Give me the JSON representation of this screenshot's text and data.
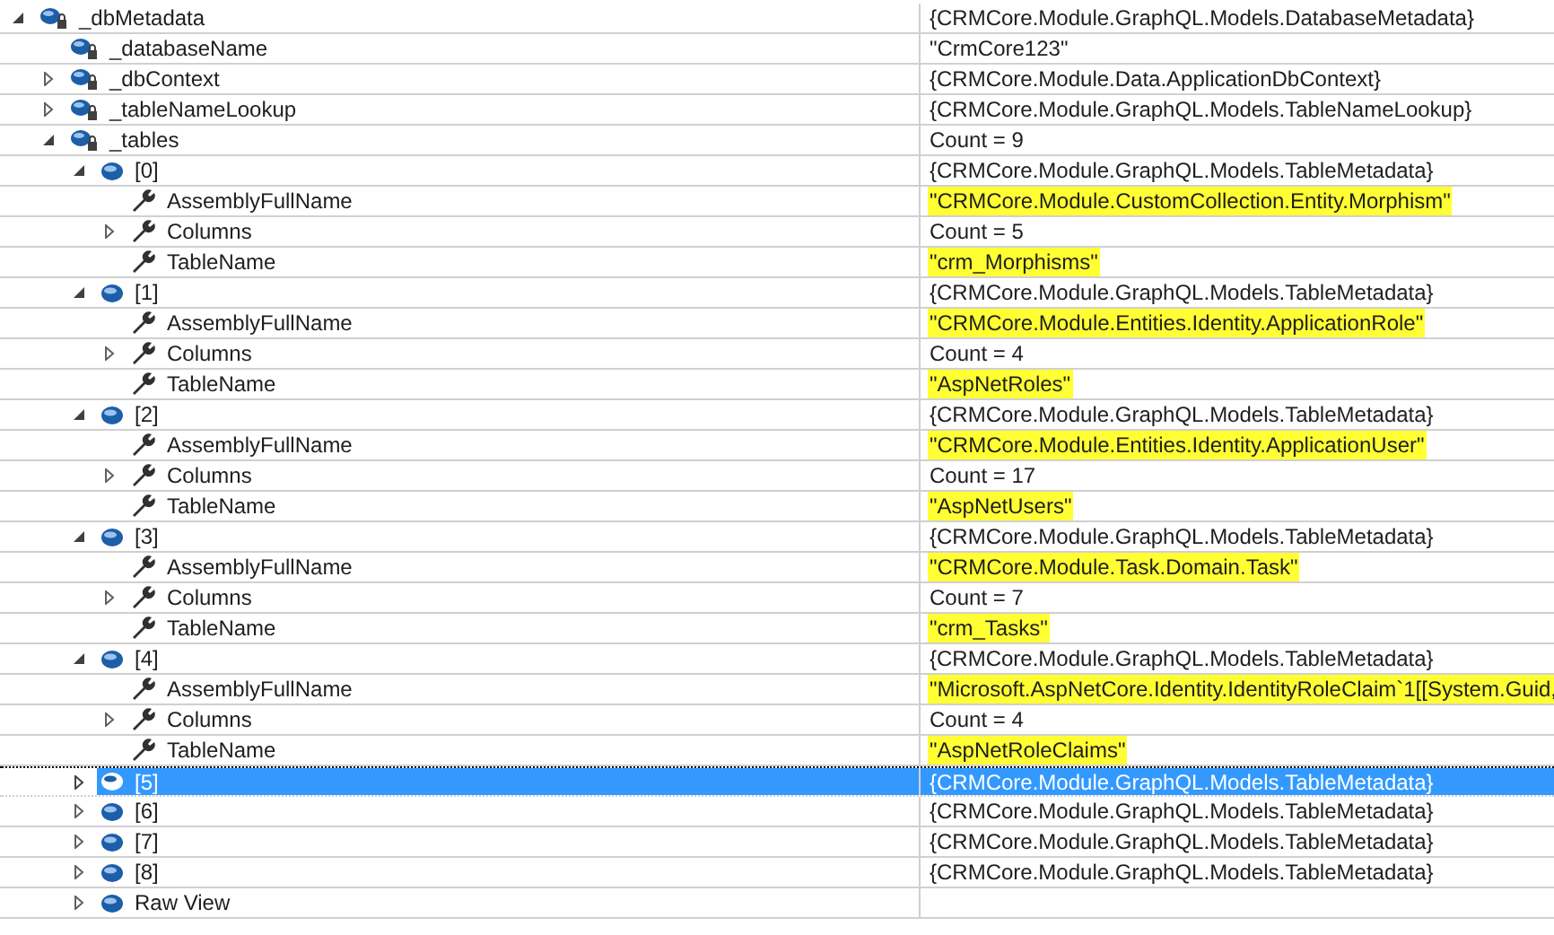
{
  "rows": [
    {
      "name": "_dbMetadata",
      "kind": "field",
      "expanded": true,
      "value": "{CRMCore.Module.GraphQL.Models.DatabaseMetadata}",
      "highlighted": false,
      "selected": false,
      "children": [
        {
          "name": "_databaseName",
          "kind": "field",
          "value": "\"CrmCore123\"",
          "highlighted": false,
          "selected": false
        },
        {
          "name": "_dbContext",
          "kind": "field",
          "expanded": false,
          "value": "{CRMCore.Module.Data.ApplicationDbContext}",
          "highlighted": false,
          "selected": false
        },
        {
          "name": "_tableNameLookup",
          "kind": "field",
          "expanded": false,
          "value": "{CRMCore.Module.GraphQL.Models.TableNameLookup}",
          "highlighted": false,
          "selected": false
        },
        {
          "name": "_tables",
          "kind": "field",
          "expanded": true,
          "value": "Count = 9",
          "highlighted": false,
          "selected": false,
          "children": [
            {
              "name": "[0]",
              "kind": "item",
              "expanded": true,
              "value": "{CRMCore.Module.GraphQL.Models.TableMetadata}",
              "highlighted": false,
              "selected": false,
              "children": [
                {
                  "name": "AssemblyFullName",
                  "kind": "property",
                  "value": "\"CRMCore.Module.CustomCollection.Entity.Morphism\"",
                  "highlighted": true,
                  "selected": false
                },
                {
                  "name": "Columns",
                  "kind": "property",
                  "expanded": false,
                  "value": "Count = 5",
                  "highlighted": false,
                  "selected": false
                },
                {
                  "name": "TableName",
                  "kind": "property",
                  "value": "\"crm_Morphisms\"",
                  "highlighted": true,
                  "selected": false
                }
              ]
            },
            {
              "name": "[1]",
              "kind": "item",
              "expanded": true,
              "value": "{CRMCore.Module.GraphQL.Models.TableMetadata}",
              "highlighted": false,
              "selected": false,
              "children": [
                {
                  "name": "AssemblyFullName",
                  "kind": "property",
                  "value": "\"CRMCore.Module.Entities.Identity.ApplicationRole\"",
                  "highlighted": true,
                  "selected": false
                },
                {
                  "name": "Columns",
                  "kind": "property",
                  "expanded": false,
                  "value": "Count = 4",
                  "highlighted": false,
                  "selected": false
                },
                {
                  "name": "TableName",
                  "kind": "property",
                  "value": "\"AspNetRoles\"",
                  "highlighted": true,
                  "selected": false
                }
              ]
            },
            {
              "name": "[2]",
              "kind": "item",
              "expanded": true,
              "value": "{CRMCore.Module.GraphQL.Models.TableMetadata}",
              "highlighted": false,
              "selected": false,
              "children": [
                {
                  "name": "AssemblyFullName",
                  "kind": "property",
                  "value": "\"CRMCore.Module.Entities.Identity.ApplicationUser\"",
                  "highlighted": true,
                  "selected": false
                },
                {
                  "name": "Columns",
                  "kind": "property",
                  "expanded": false,
                  "value": "Count = 17",
                  "highlighted": false,
                  "selected": false
                },
                {
                  "name": "TableName",
                  "kind": "property",
                  "value": "\"AspNetUsers\"",
                  "highlighted": true,
                  "selected": false
                }
              ]
            },
            {
              "name": "[3]",
              "kind": "item",
              "expanded": true,
              "value": "{CRMCore.Module.GraphQL.Models.TableMetadata}",
              "highlighted": false,
              "selected": false,
              "children": [
                {
                  "name": "AssemblyFullName",
                  "kind": "property",
                  "value": "\"CRMCore.Module.Task.Domain.Task\"",
                  "highlighted": true,
                  "selected": false
                },
                {
                  "name": "Columns",
                  "kind": "property",
                  "expanded": false,
                  "value": "Count = 7",
                  "highlighted": false,
                  "selected": false
                },
                {
                  "name": "TableName",
                  "kind": "property",
                  "value": "\"crm_Tasks\"",
                  "highlighted": true,
                  "selected": false
                }
              ]
            },
            {
              "name": "[4]",
              "kind": "item",
              "expanded": true,
              "value": "{CRMCore.Module.GraphQL.Models.TableMetadata}",
              "highlighted": false,
              "selected": false,
              "children": [
                {
                  "name": "AssemblyFullName",
                  "kind": "property",
                  "value": "\"Microsoft.AspNetCore.Identity.IdentityRoleClaim`1[[System.Guid,",
                  "highlighted": true,
                  "selected": false
                },
                {
                  "name": "Columns",
                  "kind": "property",
                  "expanded": false,
                  "value": "Count = 4",
                  "highlighted": false,
                  "selected": false
                },
                {
                  "name": "TableName",
                  "kind": "property",
                  "value": "\"AspNetRoleClaims\"",
                  "highlighted": true,
                  "selected": false
                }
              ]
            },
            {
              "name": "[5]",
              "kind": "item",
              "expanded": false,
              "value": "{CRMCore.Module.GraphQL.Models.TableMetadata}",
              "highlighted": false,
              "selected": true
            },
            {
              "name": "[6]",
              "kind": "item",
              "expanded": false,
              "value": "{CRMCore.Module.GraphQL.Models.TableMetadata}",
              "highlighted": false,
              "selected": false
            },
            {
              "name": "[7]",
              "kind": "item",
              "expanded": false,
              "value": "{CRMCore.Module.GraphQL.Models.TableMetadata}",
              "highlighted": false,
              "selected": false
            },
            {
              "name": "[8]",
              "kind": "item",
              "expanded": false,
              "value": "{CRMCore.Module.GraphQL.Models.TableMetadata}",
              "highlighted": false,
              "selected": false
            },
            {
              "name": "Raw View",
              "kind": "item",
              "expanded": false,
              "selected": false
            }
          ]
        }
      ]
    }
  ]
}
